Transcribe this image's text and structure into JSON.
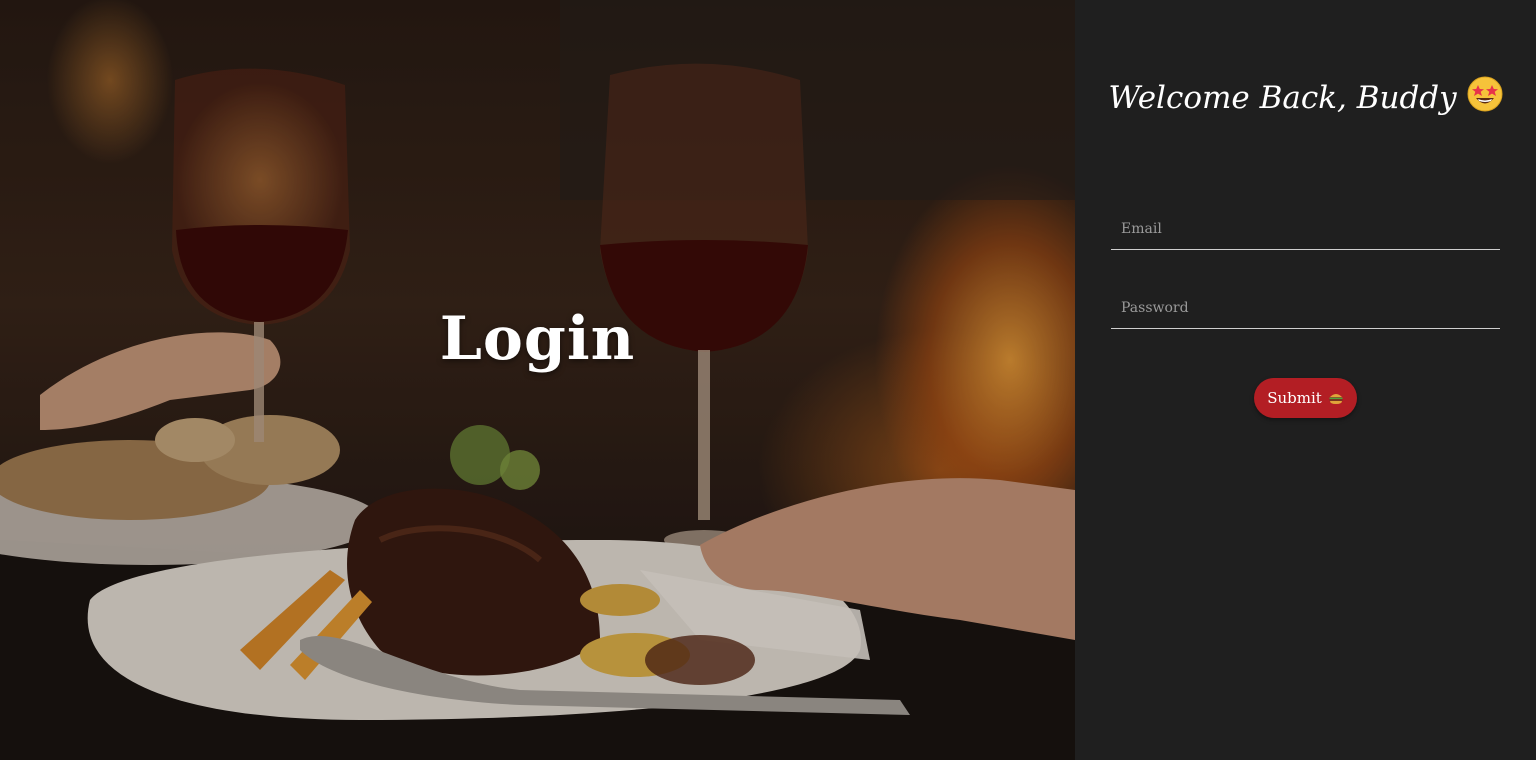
{
  "hero": {
    "title": "Login"
  },
  "form": {
    "welcome": "Welcome Back, Buddy",
    "welcome_icon": "star-struck-emoji-icon",
    "email_placeholder": "Email",
    "password_placeholder": "Password",
    "submit_label": "Submit",
    "submit_icon": "burger-icon"
  },
  "colors": {
    "panel_bg": "#1f1f1f",
    "submit_bg": "#b31e24",
    "text": "#ffffff"
  }
}
